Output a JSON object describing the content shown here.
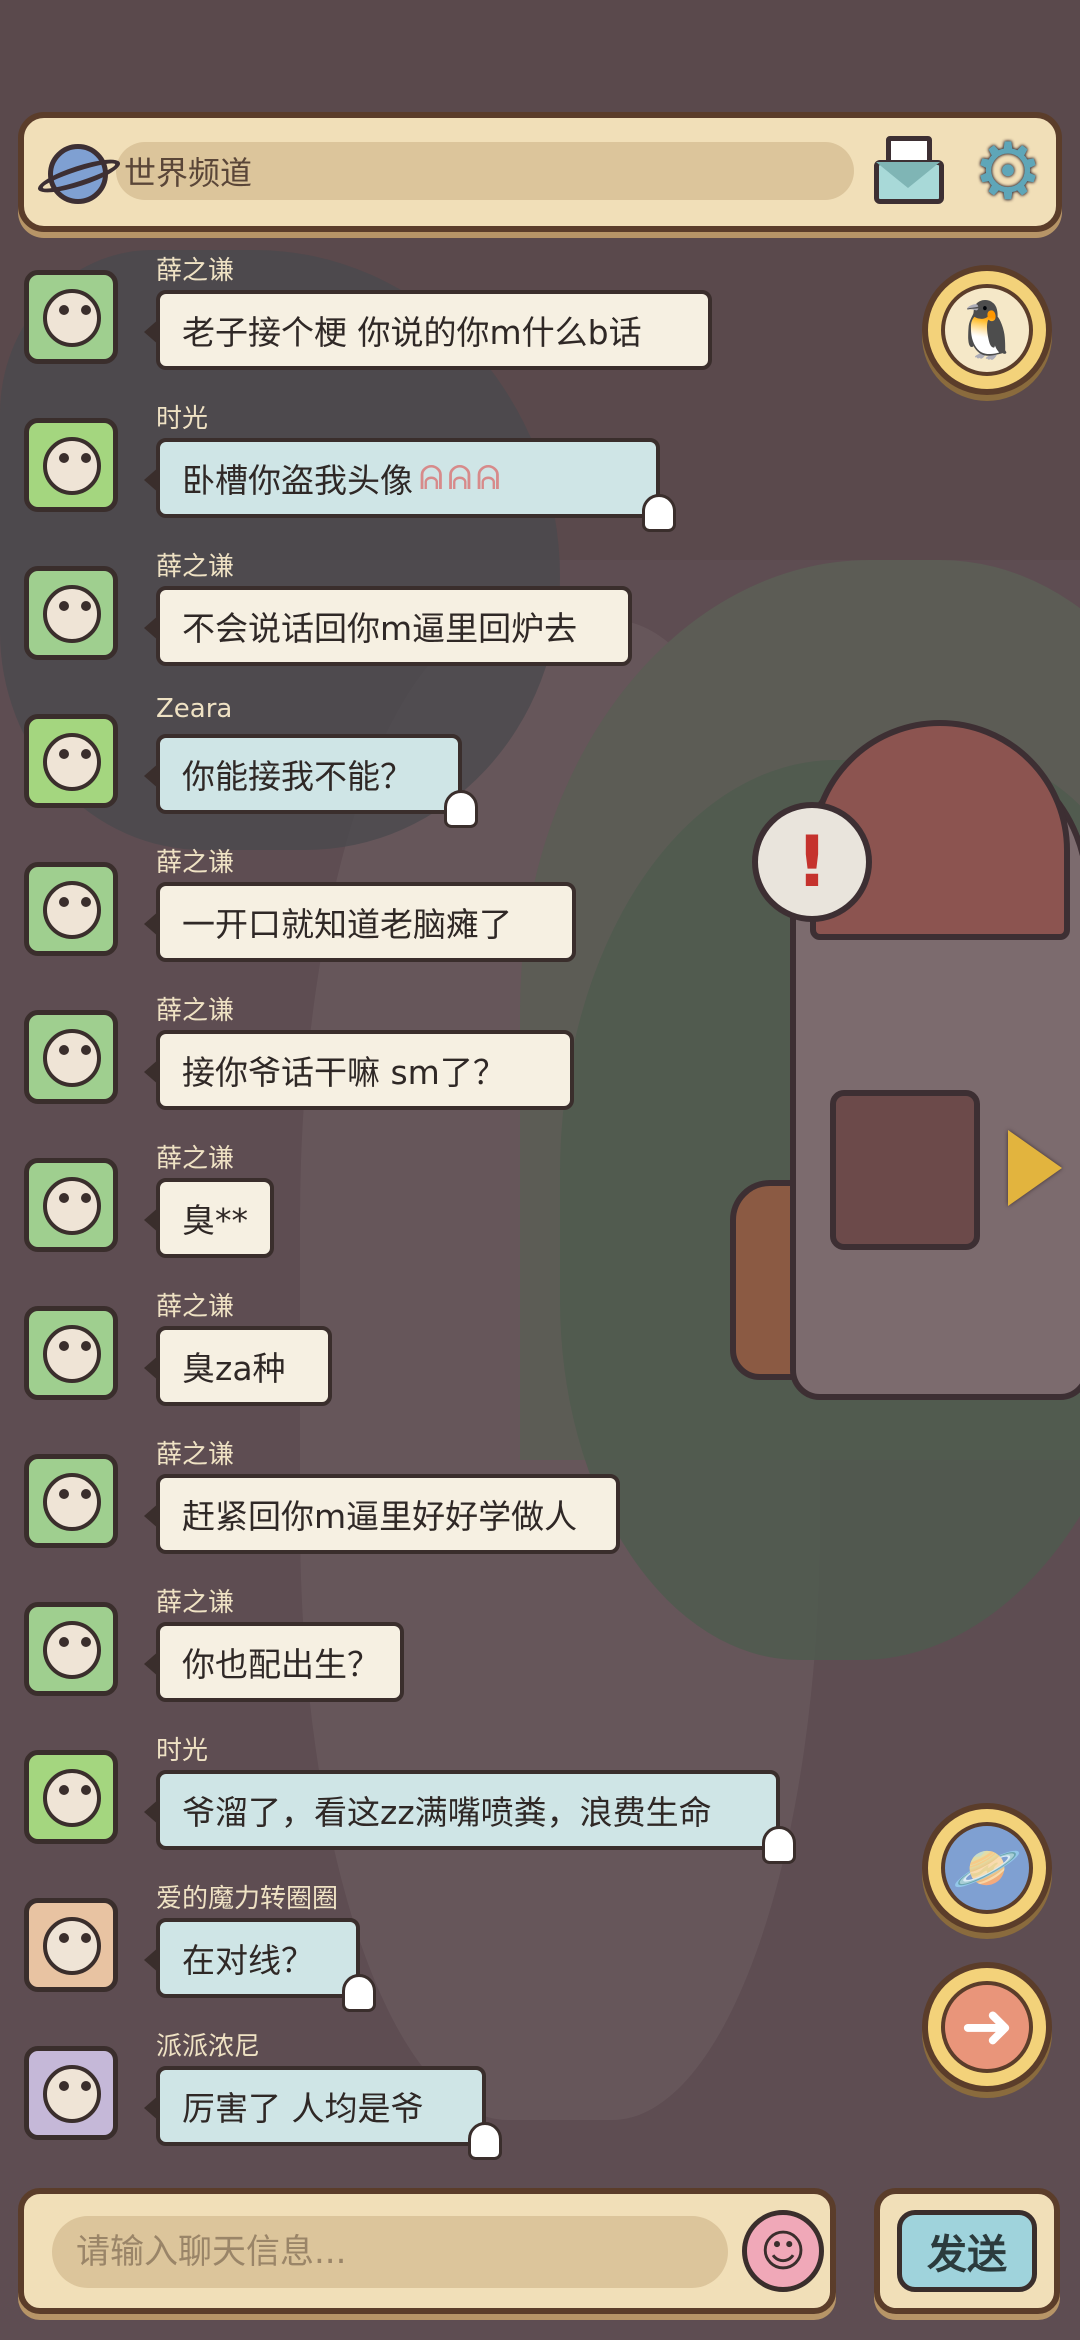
{
  "channel": {
    "label": "世界频道",
    "icon": "planet-icon"
  },
  "toolbar": {
    "mail_icon": "mail-icon",
    "settings_icon": "gear-icon"
  },
  "side_buttons": {
    "qq": "qq-penguin-icon",
    "world": "planet-icon",
    "next": "arrow-right-icon"
  },
  "messages": [
    {
      "sender": "薛之谦",
      "text": "老子接个梗  你说的你m什么b话",
      "style": "cream",
      "avatar": "green"
    },
    {
      "sender": "时光",
      "text": "卧槽你盗我头像",
      "style": "blue",
      "avatar": "frog",
      "emoji": "ᕱᕱᕱ"
    },
    {
      "sender": "薛之谦",
      "text": "不会说话回你m逼里回炉去",
      "style": "cream",
      "avatar": "green"
    },
    {
      "sender": "Zeara",
      "text": "你能接我不能？",
      "style": "blue",
      "avatar": "frog"
    },
    {
      "sender": "薛之谦",
      "text": "一开口就知道老脑瘫了",
      "style": "cream",
      "avatar": "green"
    },
    {
      "sender": "薛之谦",
      "text": "接你爷话干嘛 sm了？",
      "style": "cream",
      "avatar": "green"
    },
    {
      "sender": "薛之谦",
      "text": "臭**",
      "style": "cream",
      "avatar": "green"
    },
    {
      "sender": "薛之谦",
      "text": "臭za种",
      "style": "cream",
      "avatar": "green"
    },
    {
      "sender": "薛之谦",
      "text": "赶紧回你m逼里好好学做人",
      "style": "cream",
      "avatar": "green"
    },
    {
      "sender": "薛之谦",
      "text": "你也配出生？",
      "style": "cream",
      "avatar": "green"
    },
    {
      "sender": "时光",
      "text": "爷溜了，看这zz满嘴喷粪，浪费生命",
      "style": "blue",
      "avatar": "frog"
    },
    {
      "sender": "爱的魔力转圈圈",
      "text": "在对线？",
      "style": "blue",
      "avatar": "cry"
    },
    {
      "sender": "派派浓尼",
      "text": "厉害了 人均是爷",
      "style": "blue",
      "avatar": "purple"
    }
  ],
  "input": {
    "placeholder": "请输入聊天信息...",
    "value": "",
    "emoji_icon": "snail-emoji-icon"
  },
  "send": {
    "label": "发送"
  }
}
